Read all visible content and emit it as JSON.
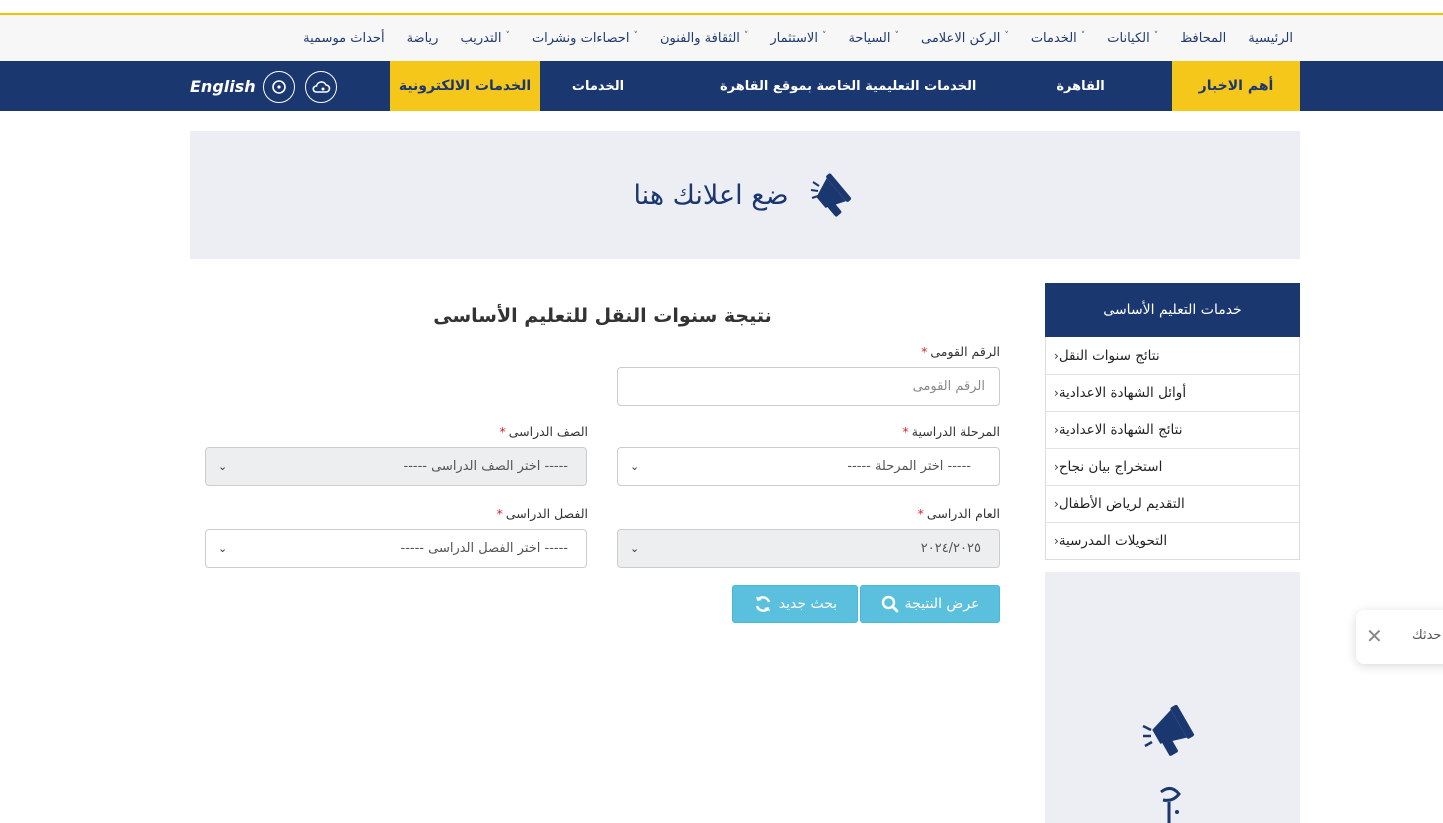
{
  "topnav": {
    "items": [
      {
        "label": "الرئيسية",
        "dropdown": false
      },
      {
        "label": "المحافظ",
        "dropdown": false
      },
      {
        "label": "الكيانات",
        "dropdown": true
      },
      {
        "label": "الخدمات",
        "dropdown": true
      },
      {
        "label": "الركن الاعلامى",
        "dropdown": true
      },
      {
        "label": "السياحة",
        "dropdown": true
      },
      {
        "label": "الاستثمار",
        "dropdown": true
      },
      {
        "label": "الثقافة والفنون",
        "dropdown": true
      },
      {
        "label": "احصاءات ونشرات",
        "dropdown": true
      },
      {
        "label": "التدريب",
        "dropdown": true
      },
      {
        "label": "رياضة",
        "dropdown": false
      },
      {
        "label": "أحداث موسمية",
        "dropdown": false
      }
    ]
  },
  "bluebar": {
    "news_label": "أهم الاخبار",
    "ticker_1": "موقع القاهرة",
    "ticker_2": "الخدمات التعليمية الخاصة بموقع القاهرة",
    "services_label": "الخدمات",
    "eservices_label": "الخدمات الالكترونية",
    "language_label": "English"
  },
  "ad_banner": {
    "text": "ضع اعلانك هنا"
  },
  "sidebar": {
    "heading": "خدمات التعليم الأساسى",
    "items": [
      "نتائج سنوات النقل",
      "أوائل الشهادة الاعدادية",
      "نتائج الشهادة الاعدادية",
      "استخراج بيان نجاح",
      "التقديم لرياض الأطفال",
      "التحويلات المدرسية"
    ]
  },
  "form": {
    "title": "نتيجة سنوات النقل للتعليم الأساسى",
    "national_id": {
      "label": "الرقم القومى",
      "placeholder": "الرقم القومى"
    },
    "stage": {
      "label": "المرحلة الدراسية",
      "value": "----- اختر المرحلة -----"
    },
    "grade": {
      "label": "الصف الدراسى",
      "value": "----- اختر الصف الدراسى -----"
    },
    "year": {
      "label": "العام الدراسى",
      "value": "٢٠٢٤/٢٠٢٥"
    },
    "term": {
      "label": "الفصل الدراسى",
      "value": "----- اختر الفصل الدراسى -----"
    },
    "required_mark": "*",
    "show_result_button": "عرض النتيجة",
    "new_search_button": "بحث جديد"
  },
  "chat_popup": {
    "text": "حدثك"
  },
  "icons": {
    "ad": "megaphone-icon",
    "weather": "cloud-icon",
    "clock": "clock-icon",
    "search": "search-icon",
    "refresh": "refresh-icon",
    "close": "close-icon"
  },
  "colors": {
    "navy": "#1b3770",
    "yellow": "#f6c71b",
    "button": "#5bc0de",
    "required": "#d9262a"
  }
}
